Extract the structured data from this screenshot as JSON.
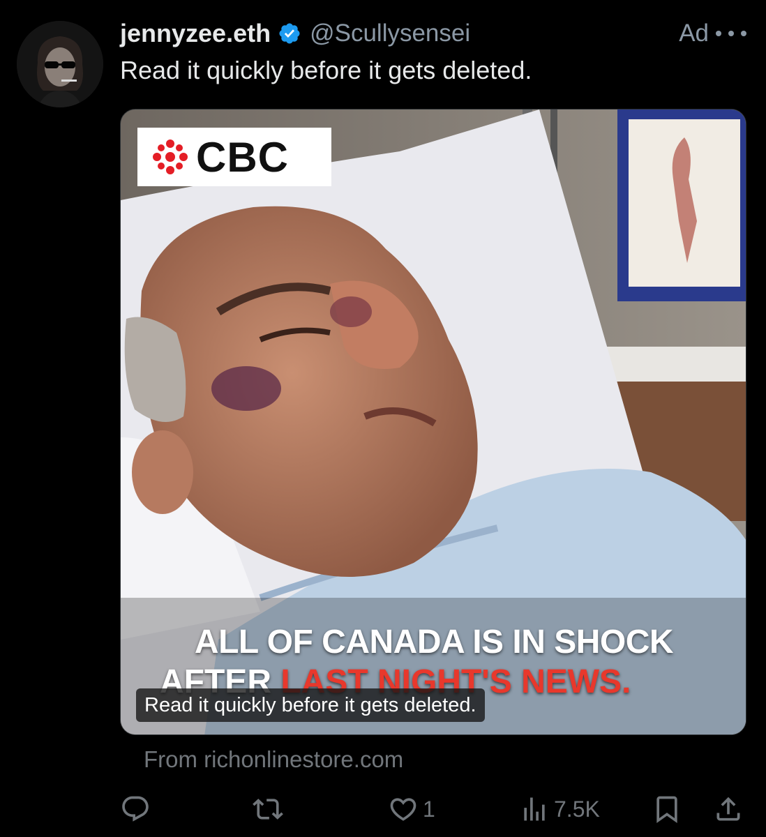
{
  "author": {
    "display_name": "jennyzee.eth",
    "handle": "@Scullysensei",
    "verified_icon": "verified-badge-icon",
    "avatar_icon": "avatar"
  },
  "ad_label": "Ad",
  "tweet_text": "Read it quickly before it gets deleted.",
  "media": {
    "logo_text": "CBC",
    "headline_line1": "ALL OF CANADA IS IN SHOCK",
    "headline_line2_white": "AFTER ",
    "headline_line2_red": "LAST NIGHT'S NEWS.",
    "caption": "Read it quickly before it gets deleted."
  },
  "source_text": "From richonlinestore.com",
  "actions": {
    "reply_count": "",
    "retweet_count": "",
    "like_count": "1",
    "views_count": "7.5K"
  },
  "colors": {
    "background": "#000000",
    "verified_blue": "#1d9bf0",
    "muted_text": "#71767b",
    "headline_red": "#e8382c",
    "cbc_red": "#e41e26"
  }
}
